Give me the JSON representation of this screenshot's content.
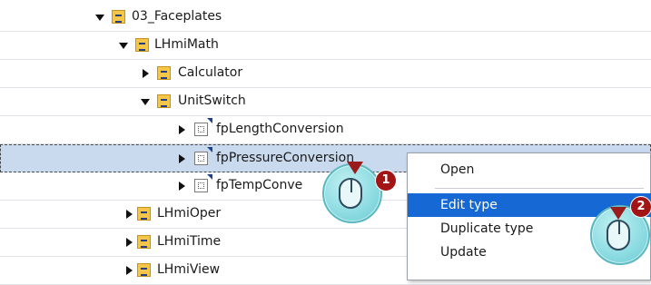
{
  "tree": {
    "rows": [
      {
        "label": "03_Faceplates",
        "type": "folder",
        "expanded": true
      },
      {
        "label": "LHmiMath",
        "type": "folder",
        "expanded": true
      },
      {
        "label": "Calculator",
        "type": "folder",
        "expanded": false
      },
      {
        "label": "UnitSwitch",
        "type": "folder",
        "expanded": true
      },
      {
        "label": "fpLengthConversion",
        "type": "faceplate",
        "expanded": false
      },
      {
        "label": "fpPressureConversion",
        "type": "faceplate",
        "expanded": false,
        "selected": true
      },
      {
        "label": "fpTempConve",
        "type": "faceplate",
        "expanded": false
      },
      {
        "label": "LHmiOper",
        "type": "folder",
        "expanded": false
      },
      {
        "label": "LHmiTime",
        "type": "folder",
        "expanded": false
      },
      {
        "label": "LHmiView",
        "type": "folder",
        "expanded": false
      }
    ]
  },
  "context_menu": {
    "items": [
      {
        "label": "Open"
      },
      {
        "label": "Edit type",
        "active": true
      },
      {
        "label": "Duplicate type"
      },
      {
        "label": "Update"
      }
    ]
  },
  "hints": {
    "step1": "1",
    "step2": "2"
  },
  "colors": {
    "selection": "#c9d9ee",
    "menu_active": "#1669d4",
    "hint_badge": "#a31515",
    "hint_circle": "#8fdde3"
  },
  "icons": {
    "folder": "library-folder-icon",
    "faceplate": "faceplate-type-icon",
    "expand": "triangle-right-icon",
    "collapse": "triangle-down-icon",
    "mouse": "mouse-click-icon"
  }
}
